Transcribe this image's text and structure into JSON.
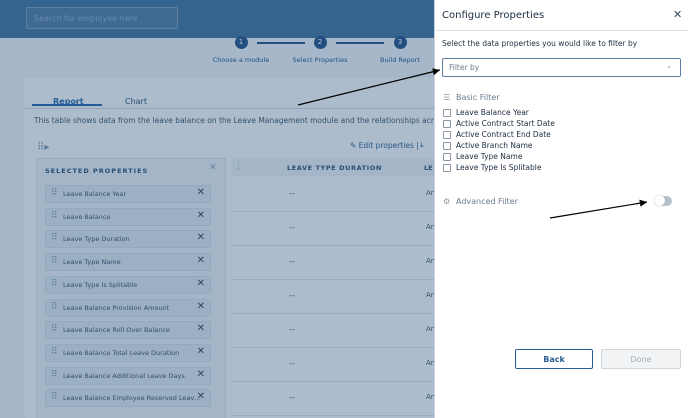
{
  "header": {
    "search_placeholder": "Search for employee here"
  },
  "steps": [
    {
      "number": "1",
      "label": "Choose a module"
    },
    {
      "number": "2",
      "label": "Select Properties"
    },
    {
      "number": "3",
      "label": "Build Report"
    }
  ],
  "tabs": [
    {
      "label": "Report"
    },
    {
      "label": "Chart"
    }
  ],
  "description": "This table shows data from the leave balance on the Leave Management module and the relationships across other",
  "toolbar": {
    "edit_label": "Edit properties",
    "separator": "|"
  },
  "selected_properties": {
    "title": "SELECTED PROPERTIES",
    "items": [
      "Leave Balance Year",
      "Leave Balance",
      "Leave Type Duration",
      "Leave Type Name",
      "Leave Type Is Splitable",
      "Leave Balance Provision Amount",
      "Leave Balance Roll Over Balance",
      "Leave Balance Total Leave Duration",
      "Leave Balance Additional Leave Days",
      "Leave Balance Employee Reserved Leave Da..."
    ]
  },
  "table": {
    "columns": [
      "LEAVE TYPE DURATION",
      "LE"
    ],
    "rows": [
      [
        "--",
        "An"
      ],
      [
        "--",
        "An"
      ],
      [
        "--",
        "An"
      ],
      [
        "--",
        "An"
      ],
      [
        "--",
        "An"
      ],
      [
        "--",
        "An"
      ],
      [
        "--",
        "An"
      ]
    ]
  },
  "modal": {
    "title": "Configure Properties",
    "subtitle": "Select the data properties you would like to filter by",
    "filter_placeholder": "Filter by",
    "basic_filter_label": "Basic Filter",
    "checkboxes": [
      "Leave Balance Year",
      "Active Contract Start Date",
      "Active Contract End Date",
      "Active Branch Name",
      "Leave Type Name",
      "Leave Type Is Splitable"
    ],
    "advanced_filter_label": "Advanced Filter",
    "advanced_filter_on": false,
    "back_label": "Back",
    "done_label": "Done"
  },
  "colors": {
    "primary": "#2a5d93",
    "overlay": "#284f78"
  }
}
